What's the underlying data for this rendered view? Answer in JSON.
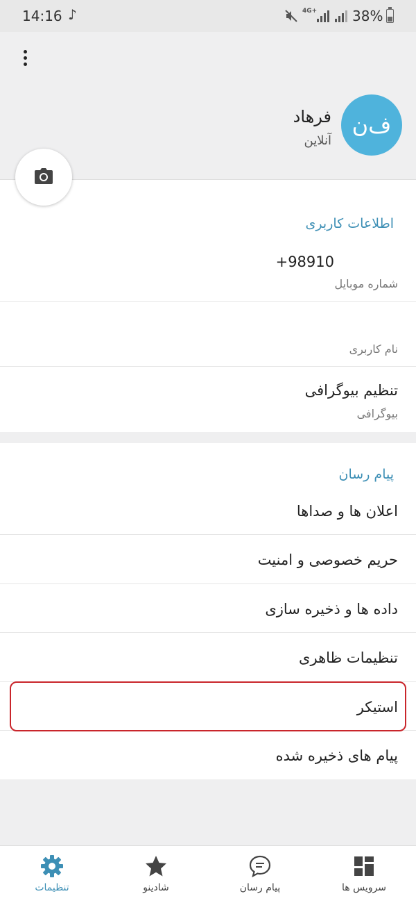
{
  "status_bar": {
    "time": "14:16",
    "network": "4G+",
    "battery": "38%",
    "battery_level": 0.38
  },
  "profile": {
    "initials": "ف‌ن",
    "name": "فرهاد",
    "status": "آنلاین",
    "avatar_color": "#4fb3dc"
  },
  "user_info": {
    "title": "اطلاعات کاربری",
    "phone": "+98910",
    "phone_label": "شماره موبایل",
    "username_label": "نام کاربری",
    "bio_title": "تنظیم بیوگرافی",
    "bio_label": "بیوگرافی"
  },
  "messenger": {
    "title": "پیام رسان",
    "items": [
      "اعلان ها و صداها",
      "حریم خصوصی و امنیت",
      "داده ها و ذخیره سازی",
      "تنظیمات ظاهری",
      "استیکر",
      "پیام های ذخیره شده"
    ]
  },
  "bottom_nav": {
    "items": [
      {
        "label": "سرویس ها",
        "icon": "grid-icon"
      },
      {
        "label": "پیام رسان",
        "icon": "chat-bubble-icon"
      },
      {
        "label": "شادینو",
        "icon": "star-icon"
      },
      {
        "label": "تنظیمات",
        "icon": "gear-icon",
        "active": true
      }
    ]
  },
  "colors": {
    "accent": "#3d8fb5",
    "highlight_border": "#c9252b",
    "background": "#efeff0"
  }
}
